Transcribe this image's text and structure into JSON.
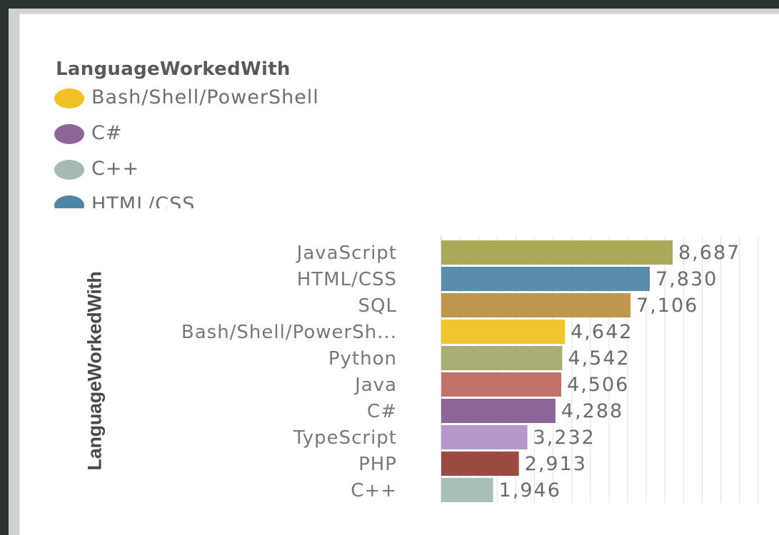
{
  "legend": {
    "title": "LanguageWorkedWith",
    "items": [
      {
        "label": "Bash/Shell/PowerShell",
        "color": "#f0c225"
      },
      {
        "label": "C#",
        "color": "#8e6598"
      },
      {
        "label": "C++",
        "color": "#a6bab2"
      },
      {
        "label": "HTML/CSS",
        "color": "#4f86a5"
      }
    ]
  },
  "chart_data": {
    "type": "bar",
    "orientation": "horizontal",
    "ylabel": "LanguageWorkedWith",
    "categories": [
      "JavaScript",
      "HTML/CSS",
      "SQL",
      "Bash/Shell/PowerSh...",
      "Python",
      "Java",
      "C#",
      "TypeScript",
      "PHP",
      "C++"
    ],
    "values": [
      8687,
      7830,
      7106,
      4642,
      4542,
      4506,
      4288,
      3232,
      2913,
      1946
    ],
    "value_labels": [
      "8,687",
      "7,830",
      "7,106",
      "4,642",
      "4,542",
      "4,506",
      "4,288",
      "3,232",
      "2,913",
      "1,946"
    ],
    "colors": [
      "#a8aa58",
      "#5a8cab",
      "#bf9650",
      "#f0c52e",
      "#a9ae74",
      "#c2726a",
      "#8e6598",
      "#b597cb",
      "#9a4a43",
      "#a9c0b8"
    ],
    "xlim": [
      0,
      12000
    ],
    "grid": true
  }
}
